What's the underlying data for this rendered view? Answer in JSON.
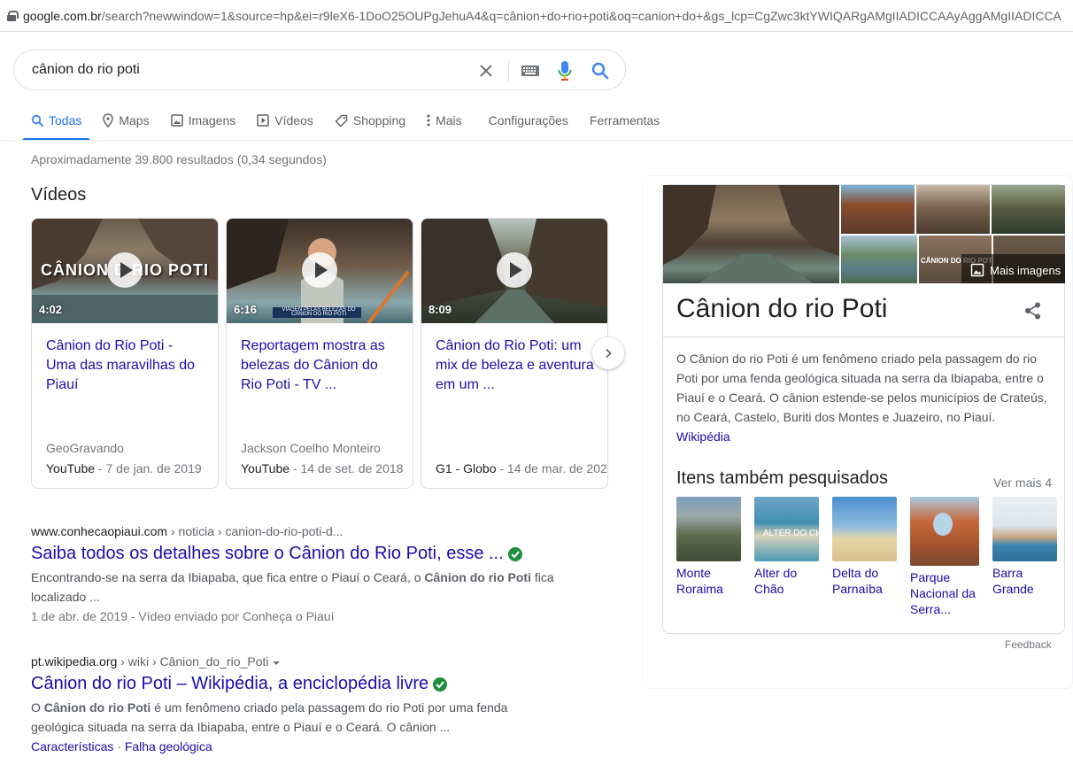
{
  "url": {
    "host": "google.com.br",
    "rest": "/search?newwindow=1&source=hp&ei=r9leX6-1DoO25OUPgJehuA4&q=cânion+do+rio+poti&oq=canion+do+&gs_lcp=CgZwc3ktYWIQARgAMgIIADICCAAyAggAMgIIADICCA"
  },
  "search": {
    "query": "cânion do rio poti"
  },
  "tabs": [
    {
      "label": "Todas",
      "icon": "search-icon",
      "active": true
    },
    {
      "label": "Maps",
      "icon": "map-pin-icon"
    },
    {
      "label": "Imagens",
      "icon": "image-icon"
    },
    {
      "label": "Vídeos",
      "icon": "video-icon"
    },
    {
      "label": "Shopping",
      "icon": "tag-icon"
    },
    {
      "label": "Mais",
      "icon": "more-vert-icon"
    },
    {
      "label": "Configurações"
    },
    {
      "label": "Ferramentas"
    }
  ],
  "stats": "Aproximadamente 39.800 resultados (0,34 segundos)",
  "videos_title": "Vídeos",
  "videos": [
    {
      "title": "Cânion do Rio Poti - Uma das maravilhas do Piauí",
      "duration": "4:02",
      "channel": "GeoGravando",
      "source": "YouTube",
      "date": " - 7 de jan. de 2019",
      "overlay": "CÂNION D  RIO POTI"
    },
    {
      "title": "Reportagem mostra as belezas do Cânion do Rio Poti - TV ...",
      "duration": "6:16",
      "channel": "Jackson Coelho Monteiro",
      "source": "YouTube",
      "date": " - 14 de set. de 2018",
      "overlay": "VIAGEN PELAS BELEZAS DO CÂNION DO RIO POTI"
    },
    {
      "title": "Cânion do Rio Poti: um mix de beleza e aventura em um ...",
      "duration": "8:09",
      "channel": "",
      "source": "G1 - Globo",
      "date": " - 14 de mar. de 202",
      "overlay": ""
    }
  ],
  "results": [
    {
      "host": "www.conhecaopiaui.com",
      "path": " › noticia › canion-do-rio-poti-d...",
      "title": "Saiba todos os detalhes sobre o Cânion do Rio Poti, esse ...",
      "snippet_pre": "Encontrando-se na serra da Ibiapaba, que fica entre o Piauí o Ceará, o ",
      "snippet_bold": "Cânion do rio Poti",
      "snippet_post": " fica localizado ...",
      "meta": "1 de abr. de 2019 - Vídeo enviado por Conheça o Piauí"
    },
    {
      "host": "pt.wikipedia.org",
      "path": " › wiki › Cânion_do_rio_Poti",
      "title": "Cânion do rio Poti – Wikipédia, a enciclopédia livre",
      "snippet_pre": "O ",
      "snippet_bold": "Cânion do rio Poti",
      "snippet_post": " é um fenômeno criado pela passagem do rio Poti por uma fenda geológica situada na serra da Ibiapaba, entre o Piauí e o Ceará. O cânion ...",
      "sitelinks": [
        "Características",
        "Falha geológica"
      ]
    }
  ],
  "panel": {
    "more_images": "Mais imagens",
    "image_overlay": "CÂNION DO RIO POTI",
    "title": "Cânion do rio Poti",
    "description": "O Cânion do rio Poti é um fenômeno criado pela passagem do rio Poti por uma fenda geológica situada na serra da Ibiapaba, entre o Piauí e o Ceará. O cânion estende-se pelos municípios de Crateús, no Ceará, Castelo, Buriti dos Montes e Juazeiro, no Piauí.",
    "source": "Wikipédia",
    "also_searched": "Itens também pesquisados",
    "see_more": "Ver mais 4",
    "related": [
      {
        "label": "Monte Roraima"
      },
      {
        "label": "Alter do Chão",
        "overlay": "ALTER DO CH"
      },
      {
        "label": "Delta do Parnaíba"
      },
      {
        "label": "Parque Nacional da Serra..."
      },
      {
        "label": "Barra Grande"
      }
    ],
    "feedback": "Feedback"
  },
  "colors": {
    "link": "#1a0dab",
    "accent": "#1a73e8",
    "verified": "#1e8e3e"
  }
}
